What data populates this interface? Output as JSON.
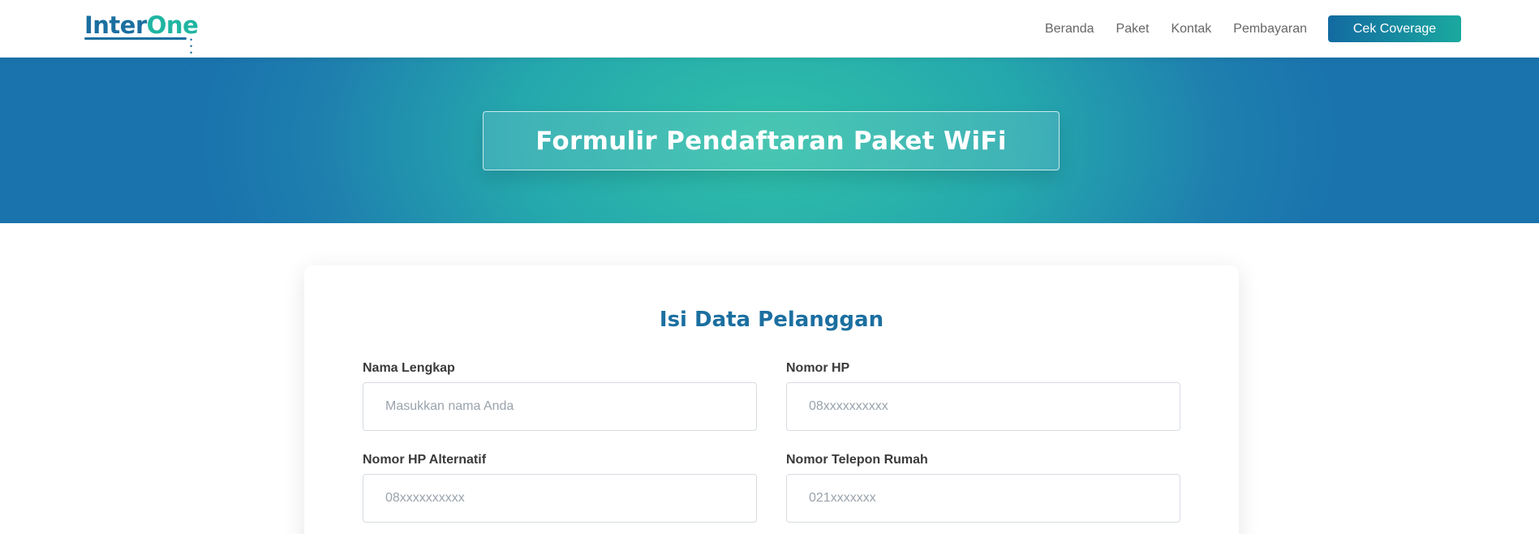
{
  "brand": {
    "logo_inter": "Inter",
    "logo_one": "One",
    "logo_dots": "• • • • •"
  },
  "nav": {
    "items": [
      {
        "label": "Beranda"
      },
      {
        "label": "Paket"
      },
      {
        "label": "Kontak"
      },
      {
        "label": "Pembayaran"
      }
    ],
    "cta_label": "Cek Coverage"
  },
  "hero": {
    "title": "Formulir Pendaftaran Paket WiFi"
  },
  "form": {
    "title": "Isi Data Pelanggan",
    "fields": [
      {
        "label": "Nama Lengkap",
        "placeholder": "Masukkan nama Anda",
        "value": ""
      },
      {
        "label": "Nomor HP",
        "placeholder": "08xxxxxxxxxx",
        "value": ""
      },
      {
        "label": "Nomor HP Alternatif",
        "placeholder": "08xxxxxxxxxx",
        "value": ""
      },
      {
        "label": "Nomor Telepon Rumah",
        "placeholder": "021xxxxxxx",
        "value": ""
      }
    ]
  },
  "colors": {
    "primary": "#1b6fa0",
    "accent": "#1fb5a2",
    "hero_center": "#2fc0a8",
    "hero_edge": "#1a73ad"
  }
}
